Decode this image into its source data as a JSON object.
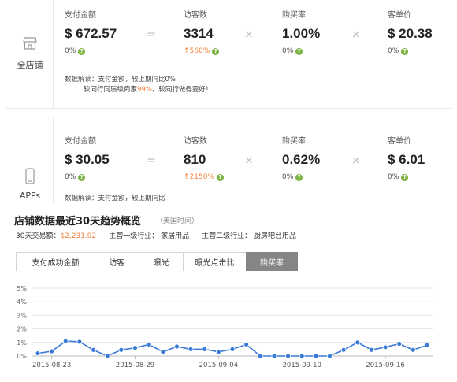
{
  "store": {
    "name": "全店铺",
    "metrics": [
      {
        "label": "支付金额",
        "value": "$ 672.57",
        "delta": "0%"
      },
      {
        "label": "访客数",
        "value": "3314",
        "delta": "↑560%"
      },
      {
        "label": "购买率",
        "value": "1.00%",
        "delta": "0%"
      },
      {
        "label": "客单价",
        "value": "$ 20.38",
        "delta": "0%"
      }
    ],
    "interpretation": {
      "line1": "数据解读：支付金额，较上期同比0%",
      "line2_pre": "较同行同层级商家",
      "line2_hl": "99%",
      "line2_post": "，较同行做得要好！"
    }
  },
  "apps": {
    "name": "APPs",
    "metrics": [
      {
        "label": "支付金额",
        "value": "$ 30.05",
        "delta": "0%"
      },
      {
        "label": "访客数",
        "value": "810",
        "delta": "↑2150%"
      },
      {
        "label": "购买率",
        "value": "0.62%",
        "delta": "0%"
      },
      {
        "label": "客单价",
        "value": "$ 6.01",
        "delta": "0%"
      }
    ],
    "cut_text": "数据解读：支付金额，较上期同比"
  },
  "operators": {
    "eq": "=",
    "times": "×"
  },
  "help_mark": "?",
  "trend": {
    "title": "店铺数据最近30天趋势概览",
    "tz": "（美国时间）",
    "volume_label": "30天交易额：",
    "volume_value": "$2,231.92",
    "cat1": "主营一级行业：  家居用品",
    "cat2": "主营二级行业：  厨房吧台用品",
    "tabs": [
      "支付成功金额",
      "访客",
      "曝光",
      "曝光点击比",
      "购买率"
    ],
    "active_tab": 4
  },
  "chart_data": {
    "type": "line",
    "y_ticks": [
      "0%",
      "1%",
      "2%",
      "3%",
      "4%",
      "5%"
    ],
    "ylim": [
      0,
      5
    ],
    "x_ticks": [
      "2015-08-23",
      "2015-08-29",
      "2015-09-04",
      "2015-09-10",
      "2015-09-16"
    ],
    "x_tick_index": [
      1,
      7,
      13,
      19,
      25
    ],
    "grid": true,
    "color": "#3a7bd5",
    "values": [
      0.2,
      0.35,
      1.1,
      1.05,
      0.45,
      0.0,
      0.45,
      0.6,
      0.85,
      0.3,
      0.7,
      0.5,
      0.5,
      0.3,
      0.5,
      0.85,
      0.0,
      0.0,
      0.0,
      0.0,
      0.0,
      0.0,
      0.45,
      1.0,
      0.45,
      0.65,
      0.9,
      0.45,
      0.8
    ]
  }
}
